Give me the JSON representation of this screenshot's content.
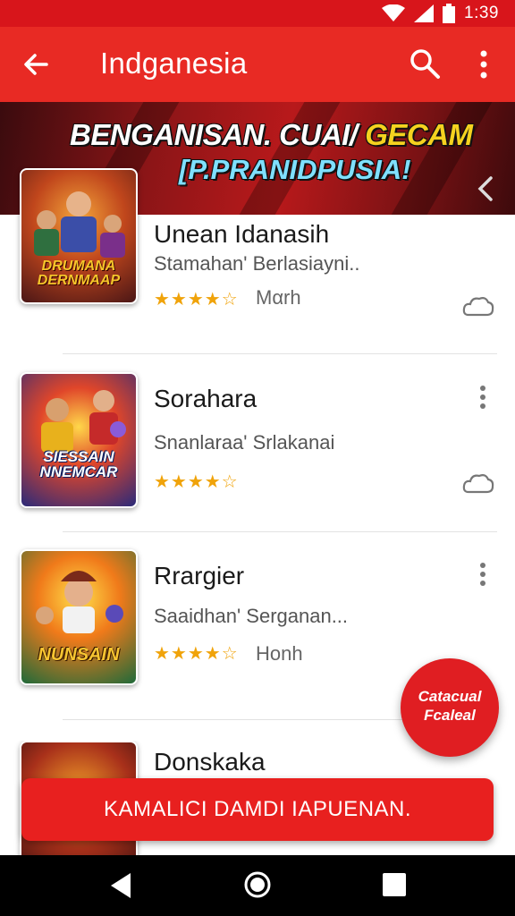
{
  "status_bar": {
    "time": "1:39"
  },
  "app_bar": {
    "title": "Indganesia"
  },
  "banner": {
    "line1_main": "BENGANISAN. CUAI/",
    "line1_accent": "GECAM",
    "line2": "[P.PRANIDPUSIA!"
  },
  "items": [
    {
      "title": "Unean Idanasih",
      "subtitle": "Stamahan' Berlasiayni..",
      "stars": "★★★★☆",
      "extra": "Mαrh",
      "thumb_text": "DRUMANA DERNMAAP"
    },
    {
      "title": "Sorahara",
      "subtitle": "Snanlaraa' Srlakanai",
      "stars": "★★★★☆",
      "extra": "",
      "thumb_text": "SIESSAIN NNEMCAR"
    },
    {
      "title": "Rrargier",
      "subtitle": "Saaidhan' Serganan...",
      "stars": "★★★★☆",
      "extra": "Honh",
      "thumb_text": "NUNSAIN"
    },
    {
      "title": "Donskaka",
      "subtitle": "",
      "stars": "",
      "extra": "",
      "thumb_text": ""
    }
  ],
  "fab": {
    "line1": "Catacual",
    "line2": "Fcaleal"
  },
  "install_bar": {
    "label": "KAMALICI DAMDI IAPUENAN."
  },
  "colors": {
    "primary": "#e82a24",
    "status": "#d8151b",
    "star": "#f0a30a"
  },
  "icons": [
    "back-arrow-icon",
    "search-icon",
    "more-vert-icon",
    "chevron-left-icon",
    "cloud-icon",
    "nav-back-icon",
    "nav-home-icon",
    "nav-recents-icon",
    "wifi-icon",
    "signal-icon",
    "battery-icon"
  ]
}
